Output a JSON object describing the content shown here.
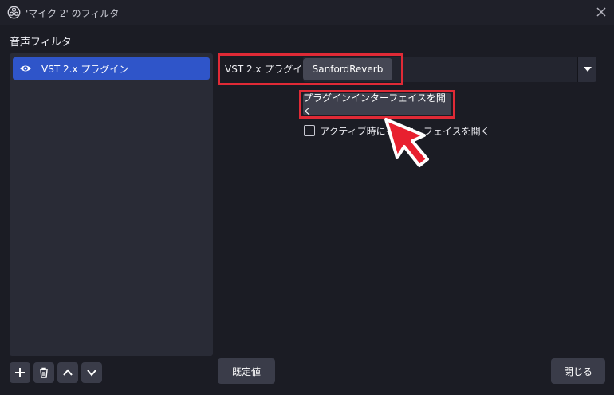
{
  "window": {
    "title": "'マイク 2' のフィルタ"
  },
  "filters": {
    "section_label": "音声フィルタ",
    "items": [
      {
        "label": "VST 2.x プラグイン",
        "visible": true,
        "selected": true
      }
    ],
    "toolbar": {
      "add_icon": "plus-icon",
      "remove_icon": "trash-icon",
      "up_icon": "chevron-up-icon",
      "down_icon": "chevron-down-icon"
    }
  },
  "properties": {
    "plugin_label": "VST 2.x プラグイン",
    "plugin_value": "SanfordReverb",
    "open_interface_label": "プラグインインターフェイスを開く",
    "open_on_active_label": "アクティブ時にインターフェイスを開く",
    "open_on_active_checked": false
  },
  "footer": {
    "defaults_label": "既定値",
    "close_label": "閉じる"
  },
  "colors": {
    "highlight": "#e02a36",
    "selection": "#2f55c9",
    "background": "#1b1c24"
  }
}
